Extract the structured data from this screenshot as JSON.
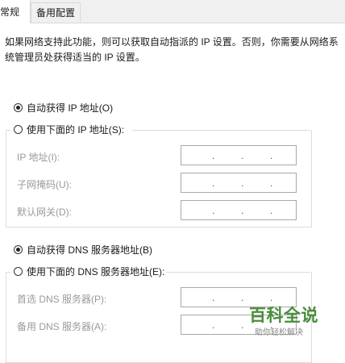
{
  "tabs": {
    "general": "常规",
    "alternate": "备用配置"
  },
  "description": "如果网络支持此功能，则可以获取自动指派的 IP 设置。否则，你需要从网络系统管理员处获得适当的 IP 设置。",
  "ip": {
    "auto_label": "自动获得 IP 地址(O)",
    "manual_label": "使用下面的 IP 地址(S):",
    "auto_selected": true,
    "address_label": "IP 地址(I):",
    "mask_label": "子网掩码(U):",
    "gateway_label": "默认网关(D):",
    "dot": "."
  },
  "dns": {
    "auto_label": "自动获得 DNS 服务器地址(B)",
    "manual_label": "使用下面的 DNS 服务器地址(E):",
    "auto_selected": true,
    "preferred_label": "首选 DNS 服务器(P):",
    "alternate_label": "备用 DNS 服务器(A):",
    "dot": "."
  },
  "watermark": {
    "title": "百科全说",
    "subtitle": "助你轻松解决"
  }
}
